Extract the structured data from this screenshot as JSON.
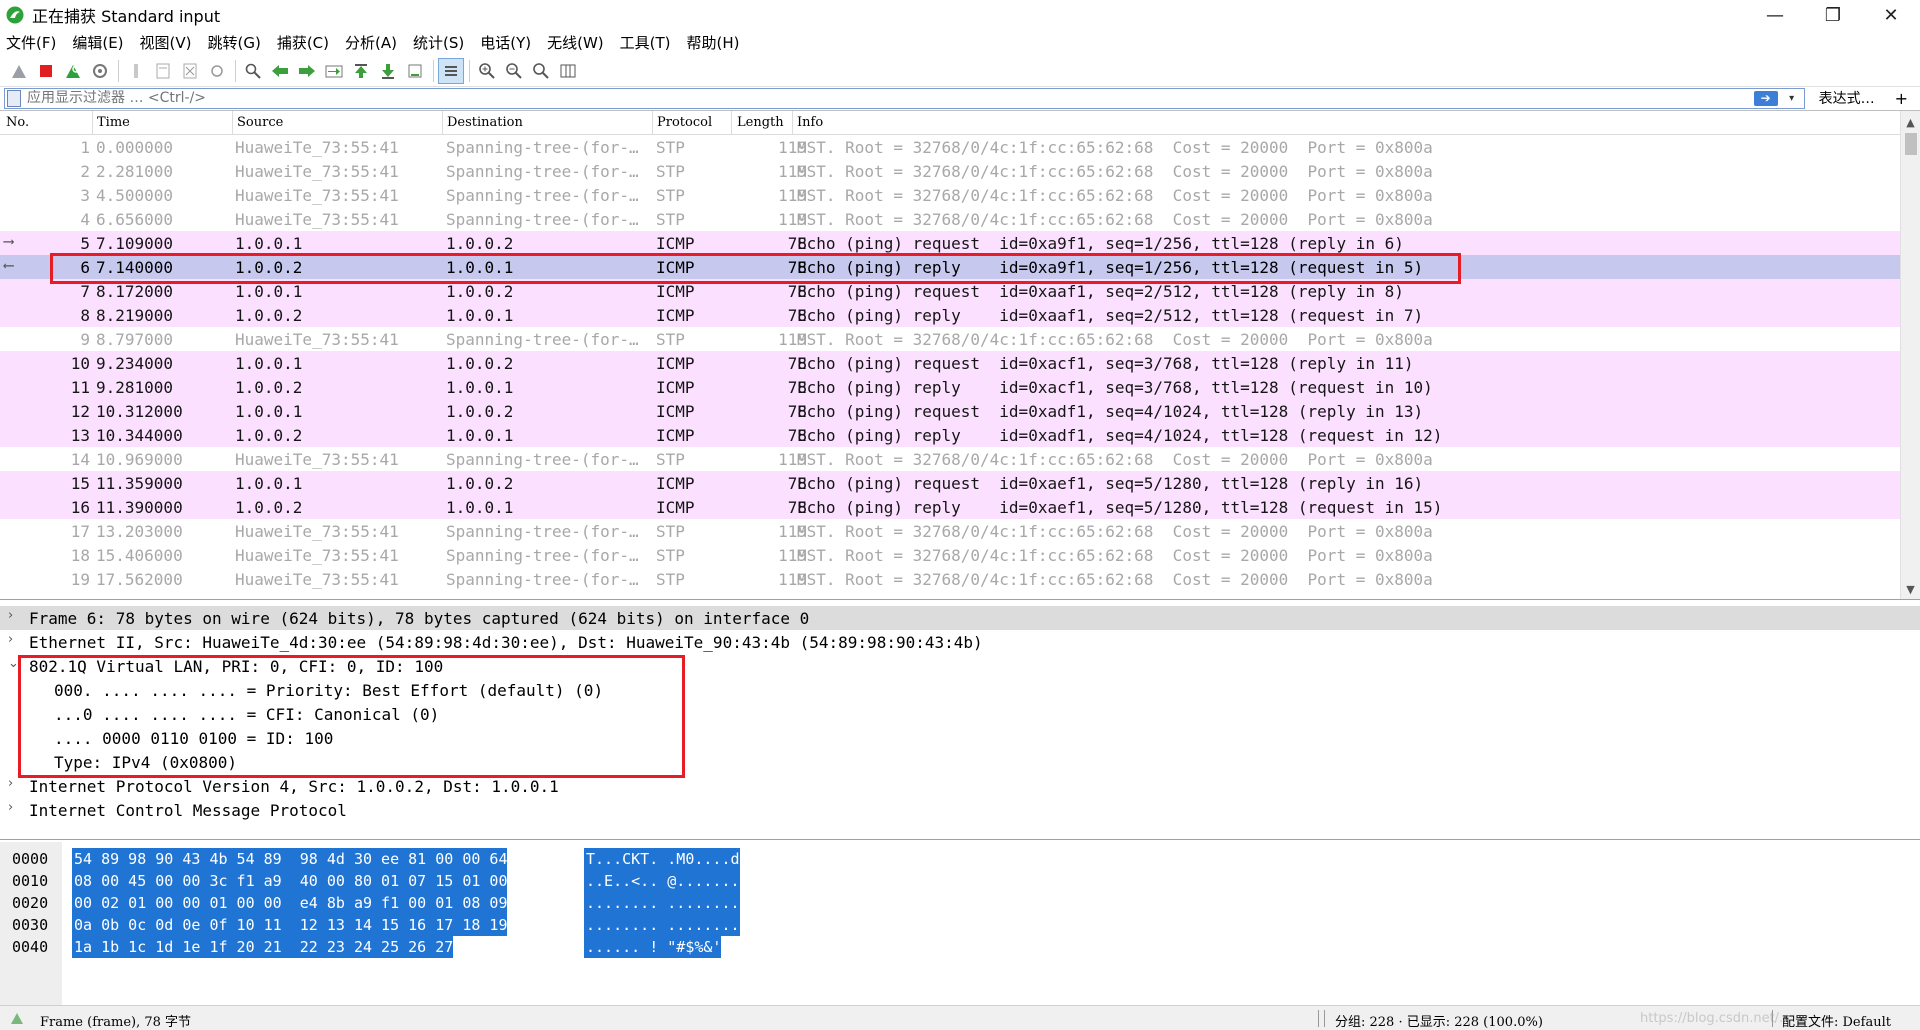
{
  "window": {
    "title": "正在捕获 Standard input",
    "controls": {
      "minimize": "—",
      "maximize": "❐",
      "close": "✕"
    }
  },
  "menu": [
    "文件(F)",
    "编辑(E)",
    "视图(V)",
    "跳转(G)",
    "捕获(C)",
    "分析(A)",
    "统计(S)",
    "电话(Y)",
    "无线(W)",
    "工具(T)",
    "帮助(H)"
  ],
  "toolbar": {
    "buttons": [
      "shark-fin-start-icon",
      "stop-capture-icon",
      "restart-capture-icon",
      "capture-options-icon",
      "open-file-icon",
      "save-file-icon",
      "close-file-icon",
      "reload-icon",
      "find-packet-icon",
      "go-back-icon",
      "go-forward-icon",
      "go-to-packet-icon",
      "first-packet-icon",
      "last-packet-icon",
      "autoscroll-icon",
      "colorize-icon",
      "zoom-in-icon",
      "zoom-out-icon",
      "zoom-normal-icon",
      "resize-columns-icon"
    ],
    "colors": {
      "stop": "#e02020",
      "green": "#2fa13a",
      "arrow": "#3c9e3c"
    }
  },
  "filter": {
    "placeholder": "应用显示过滤器 … <Ctrl-/>",
    "expression_label": "表达式…",
    "plus": "+",
    "apply_arrow": "➔",
    "dropdown": "▾"
  },
  "packet_list": {
    "columns": [
      "No.",
      "Time",
      "Source",
      "Destination",
      "Protocol",
      "Length",
      "Info"
    ],
    "rows": [
      {
        "no": "1",
        "time": "0.000000",
        "src": "HuaweiTe_73:55:41",
        "dst": "Spanning-tree-(for-…",
        "proto": "STP",
        "len": "119",
        "info": "MST. Root = 32768/0/4c:1f:cc:65:62:68  Cost = 20000  Port = 0x800a",
        "kind": "stp",
        "arrow": ""
      },
      {
        "no": "2",
        "time": "2.281000",
        "src": "HuaweiTe_73:55:41",
        "dst": "Spanning-tree-(for-…",
        "proto": "STP",
        "len": "119",
        "info": "MST. Root = 32768/0/4c:1f:cc:65:62:68  Cost = 20000  Port = 0x800a",
        "kind": "stp",
        "arrow": ""
      },
      {
        "no": "3",
        "time": "4.500000",
        "src": "HuaweiTe_73:55:41",
        "dst": "Spanning-tree-(for-…",
        "proto": "STP",
        "len": "119",
        "info": "MST. Root = 32768/0/4c:1f:cc:65:62:68  Cost = 20000  Port = 0x800a",
        "kind": "stp",
        "arrow": ""
      },
      {
        "no": "4",
        "time": "6.656000",
        "src": "HuaweiTe_73:55:41",
        "dst": "Spanning-tree-(for-…",
        "proto": "STP",
        "len": "119",
        "info": "MST. Root = 32768/0/4c:1f:cc:65:62:68  Cost = 20000  Port = 0x800a",
        "kind": "stp",
        "arrow": ""
      },
      {
        "no": "5",
        "time": "7.109000",
        "src": "1.0.0.1",
        "dst": "1.0.0.2",
        "proto": "ICMP",
        "len": "78",
        "info": "Echo (ping) request  id=0xa9f1, seq=1/256, ttl=128 (reply in 6)",
        "kind": "icmp",
        "arrow": "⟶"
      },
      {
        "no": "6",
        "time": "7.140000",
        "src": "1.0.0.2",
        "dst": "1.0.0.1",
        "proto": "ICMP",
        "len": "78",
        "info": "Echo (ping) reply    id=0xa9f1, seq=1/256, ttl=128 (request in 5)",
        "kind": "selected",
        "arrow": "⟵"
      },
      {
        "no": "7",
        "time": "8.172000",
        "src": "1.0.0.1",
        "dst": "1.0.0.2",
        "proto": "ICMP",
        "len": "78",
        "info": "Echo (ping) request  id=0xaaf1, seq=2/512, ttl=128 (reply in 8)",
        "kind": "icmp",
        "arrow": ""
      },
      {
        "no": "8",
        "time": "8.219000",
        "src": "1.0.0.2",
        "dst": "1.0.0.1",
        "proto": "ICMP",
        "len": "78",
        "info": "Echo (ping) reply    id=0xaaf1, seq=2/512, ttl=128 (request in 7)",
        "kind": "icmp",
        "arrow": ""
      },
      {
        "no": "9",
        "time": "8.797000",
        "src": "HuaweiTe_73:55:41",
        "dst": "Spanning-tree-(for-…",
        "proto": "STP",
        "len": "119",
        "info": "MST. Root = 32768/0/4c:1f:cc:65:62:68  Cost = 20000  Port = 0x800a",
        "kind": "stp",
        "arrow": ""
      },
      {
        "no": "10",
        "time": "9.234000",
        "src": "1.0.0.1",
        "dst": "1.0.0.2",
        "proto": "ICMP",
        "len": "78",
        "info": "Echo (ping) request  id=0xacf1, seq=3/768, ttl=128 (reply in 11)",
        "kind": "icmp",
        "arrow": ""
      },
      {
        "no": "11",
        "time": "9.281000",
        "src": "1.0.0.2",
        "dst": "1.0.0.1",
        "proto": "ICMP",
        "len": "78",
        "info": "Echo (ping) reply    id=0xacf1, seq=3/768, ttl=128 (request in 10)",
        "kind": "icmp",
        "arrow": ""
      },
      {
        "no": "12",
        "time": "10.312000",
        "src": "1.0.0.1",
        "dst": "1.0.0.2",
        "proto": "ICMP",
        "len": "78",
        "info": "Echo (ping) request  id=0xadf1, seq=4/1024, ttl=128 (reply in 13)",
        "kind": "icmp",
        "arrow": ""
      },
      {
        "no": "13",
        "time": "10.344000",
        "src": "1.0.0.2",
        "dst": "1.0.0.1",
        "proto": "ICMP",
        "len": "78",
        "info": "Echo (ping) reply    id=0xadf1, seq=4/1024, ttl=128 (request in 12)",
        "kind": "icmp",
        "arrow": ""
      },
      {
        "no": "14",
        "time": "10.969000",
        "src": "HuaweiTe_73:55:41",
        "dst": "Spanning-tree-(for-…",
        "proto": "STP",
        "len": "119",
        "info": "MST. Root = 32768/0/4c:1f:cc:65:62:68  Cost = 20000  Port = 0x800a",
        "kind": "stp",
        "arrow": ""
      },
      {
        "no": "15",
        "time": "11.359000",
        "src": "1.0.0.1",
        "dst": "1.0.0.2",
        "proto": "ICMP",
        "len": "78",
        "info": "Echo (ping) request  id=0xaef1, seq=5/1280, ttl=128 (reply in 16)",
        "kind": "icmp",
        "arrow": ""
      },
      {
        "no": "16",
        "time": "11.390000",
        "src": "1.0.0.2",
        "dst": "1.0.0.1",
        "proto": "ICMP",
        "len": "78",
        "info": "Echo (ping) reply    id=0xaef1, seq=5/1280, ttl=128 (request in 15)",
        "kind": "icmp",
        "arrow": ""
      },
      {
        "no": "17",
        "time": "13.203000",
        "src": "HuaweiTe_73:55:41",
        "dst": "Spanning-tree-(for-…",
        "proto": "STP",
        "len": "119",
        "info": "MST. Root = 32768/0/4c:1f:cc:65:62:68  Cost = 20000  Port = 0x800a",
        "kind": "stp",
        "arrow": ""
      },
      {
        "no": "18",
        "time": "15.406000",
        "src": "HuaweiTe_73:55:41",
        "dst": "Spanning-tree-(for-…",
        "proto": "STP",
        "len": "119",
        "info": "MST. Root = 32768/0/4c:1f:cc:65:62:68  Cost = 20000  Port = 0x800a",
        "kind": "stp",
        "arrow": ""
      },
      {
        "no": "19",
        "time": "17.562000",
        "src": "HuaweiTe_73:55:41",
        "dst": "Spanning-tree-(for-…",
        "proto": "STP",
        "len": "119",
        "info": "MST. Root = 32768/0/4c:1f:cc:65:62:68  Cost = 20000  Port = 0x800a",
        "kind": "stp",
        "arrow": ""
      }
    ],
    "row_colors": {
      "stp_text": "#a8a8a8",
      "icmp_bg": "#fce0ff",
      "selected_bg": "#c6c8ee"
    }
  },
  "details": [
    {
      "text": "Frame 6: 78 bytes on wire (624 bits), 78 bytes captured (624 bits) on interface 0",
      "toggle": "›",
      "child": false,
      "sel": true
    },
    {
      "text": "Ethernet II, Src: HuaweiTe_4d:30:ee (54:89:98:4d:30:ee), Dst: HuaweiTe_90:43:4b (54:89:98:90:43:4b)",
      "toggle": "›",
      "child": false,
      "sel": false
    },
    {
      "text": "802.1Q Virtual LAN, PRI: 0, CFI: 0, ID: 100",
      "toggle": "⌄",
      "child": false,
      "sel": false
    },
    {
      "text": "000. .... .... .... = Priority: Best Effort (default) (0)",
      "toggle": "",
      "child": true,
      "sel": false
    },
    {
      "text": "...0 .... .... .... = CFI: Canonical (0)",
      "toggle": "",
      "child": true,
      "sel": false
    },
    {
      "text": ".... 0000 0110 0100 = ID: 100",
      "toggle": "",
      "child": true,
      "sel": false
    },
    {
      "text": "Type: IPv4 (0x0800)",
      "toggle": "",
      "child": true,
      "sel": false
    },
    {
      "text": "Internet Protocol Version 4, Src: 1.0.0.2, Dst: 1.0.0.1",
      "toggle": "›",
      "child": false,
      "sel": false
    },
    {
      "text": "Internet Control Message Protocol",
      "toggle": "›",
      "child": false,
      "sel": false
    }
  ],
  "bytes": [
    {
      "offset": "0000",
      "hex": "54 89 98 90 43 4b 54 89  98 4d 30 ee 81 00 00 64",
      "ascii": "T...CKT. .M0....d"
    },
    {
      "offset": "0010",
      "hex": "08 00 45 00 00 3c f1 a9  40 00 80 01 07 15 01 00",
      "ascii": "..E..<.. @......."
    },
    {
      "offset": "0020",
      "hex": "00 02 01 00 00 01 00 00  e4 8b a9 f1 00 01 08 09",
      "ascii": "........ ........"
    },
    {
      "offset": "0030",
      "hex": "0a 0b 0c 0d 0e 0f 10 11  12 13 14 15 16 17 18 19",
      "ascii": "........ ........"
    },
    {
      "offset": "0040",
      "hex": "1a 1b 1c 1d 1e 1f 20 21  22 23 24 25 26 27",
      "ascii": "...... ! \"#$%&'"
    }
  ],
  "status": {
    "field_info": "Frame (frame), 78 字节",
    "packets": "分组: 228 · 已显示: 228 (100.0%)",
    "profile": "配置文件: Default",
    "watermark": "https://blog.csdn.net/..."
  }
}
